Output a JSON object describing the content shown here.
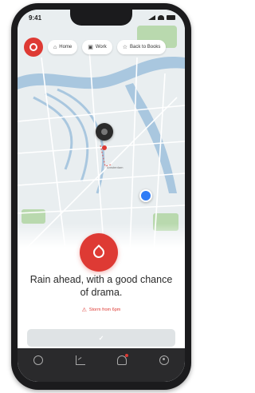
{
  "status_bar": {
    "time": "9:41"
  },
  "top_bar": {
    "chips": [
      {
        "icon": "home-icon",
        "glyph": "⌂",
        "label": "Home"
      },
      {
        "icon": "briefcase-icon",
        "glyph": "▣",
        "label": "Work"
      },
      {
        "icon": "star-icon",
        "glyph": "☆",
        "label": "Back to Books"
      }
    ]
  },
  "map": {
    "label": "Amsterdam",
    "colors": {
      "water": "#a9c7df",
      "park": "#b9d9ae",
      "road": "#ffffff",
      "base": "#e9eef0"
    }
  },
  "forecast": {
    "headline": "Rain ahead, with a good chance of drama.",
    "alert_label": "Storm from 6pm",
    "badge_icon": "rain-drop-icon"
  },
  "cta": {
    "glyph": "✓"
  },
  "tabs": [
    {
      "icon": "globe-icon"
    },
    {
      "icon": "chart-icon"
    },
    {
      "icon": "bell-icon"
    },
    {
      "icon": "profile-icon"
    }
  ],
  "colors": {
    "accent": "#de3a34",
    "location": "#2f7cf6",
    "tab_bar": "#2a2a2c"
  }
}
